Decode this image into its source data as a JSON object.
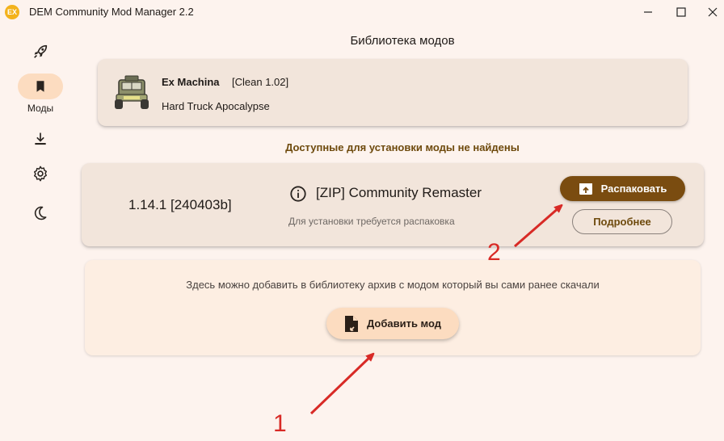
{
  "window": {
    "title": "DEM Community Mod Manager 2.2",
    "logo_text": "EX"
  },
  "sidebar": {
    "items": [
      {
        "icon": "rocket-icon",
        "label": ""
      },
      {
        "icon": "bookmark-icon",
        "label": "Моды",
        "active": true
      },
      {
        "icon": "download-icon",
        "label": ""
      },
      {
        "icon": "gear-icon",
        "label": ""
      },
      {
        "icon": "moon-icon",
        "label": ""
      }
    ]
  },
  "main": {
    "title": "Библиотека модов",
    "game": {
      "name": "Ex Machina",
      "version": "[Clean 1.02]",
      "subtitle": "Hard Truck Apocalypse"
    },
    "section_header": "Доступные для установки моды не найдены",
    "mod": {
      "version": "1.14.1 [240403b]",
      "name": "[ZIP] Community Remaster",
      "note": "Для установки требуется распаковка",
      "unpack_label": "Распаковать",
      "details_label": "Подробнее"
    },
    "add": {
      "hint": "Здесь можно добавить в библиотеку архив с модом который вы сами ранее скачали",
      "button_label": "Добавить мод"
    }
  },
  "annotations": {
    "numbers": [
      "1",
      "2"
    ],
    "color": "#d82a26"
  },
  "colors": {
    "accent": "#7a4c10",
    "background": "#fdf3ee",
    "card": "#f2e5db",
    "pill": "#fcdcc0"
  }
}
